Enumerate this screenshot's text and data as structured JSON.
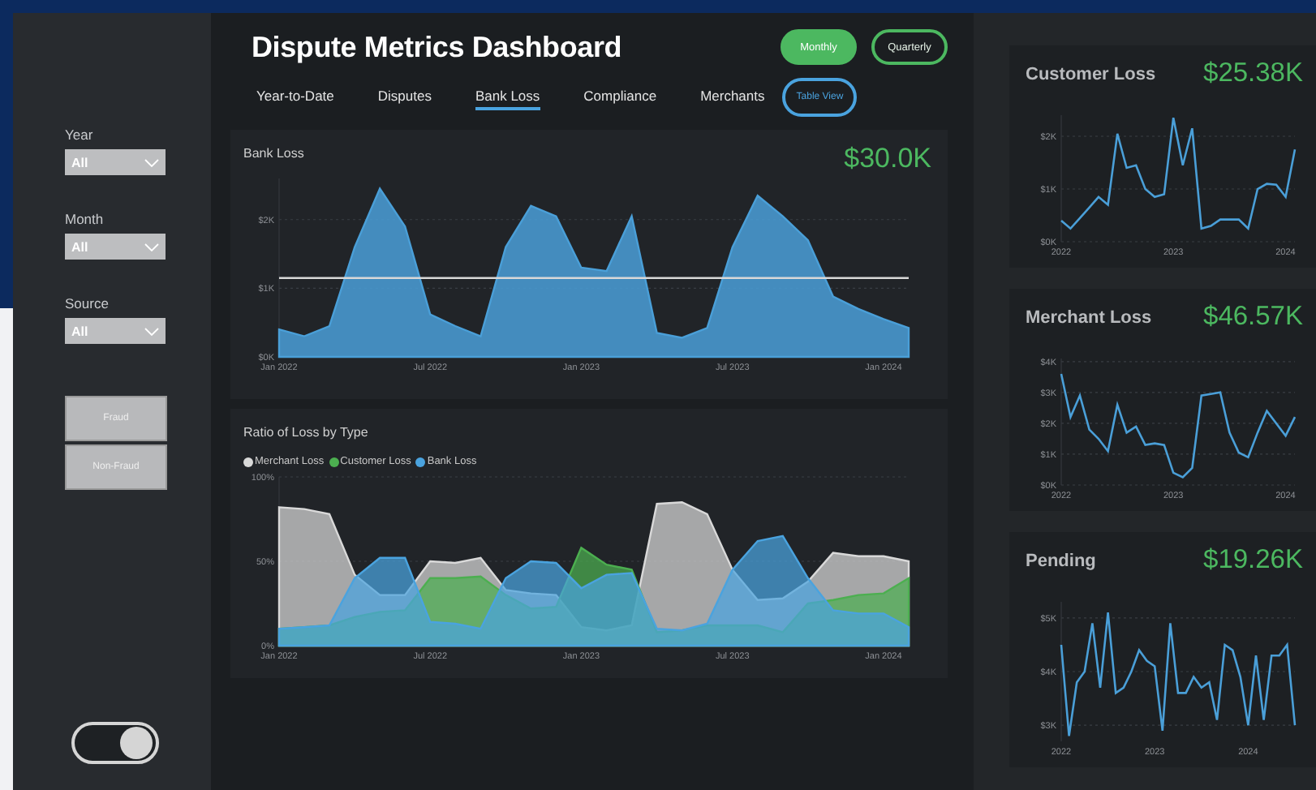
{
  "sidebar": {
    "filters": [
      {
        "label": "Year",
        "value": "All"
      },
      {
        "label": "Month",
        "value": "All"
      },
      {
        "label": "Source",
        "value": "All"
      }
    ],
    "buttons": [
      "Fraud",
      "Non-Fraud"
    ],
    "toggle": {
      "on": true
    }
  },
  "header": {
    "title": "Dispute Metrics Dashboard",
    "period_buttons": [
      {
        "label": "Monthly",
        "selected": true
      },
      {
        "label": "Quarterly",
        "selected": false
      }
    ],
    "tabs": [
      {
        "label": "Year-to-Date",
        "kind": "tab",
        "selected": false
      },
      {
        "label": "Disputes",
        "kind": "tab",
        "selected": false
      },
      {
        "label": "Bank Loss",
        "kind": "tab",
        "selected": true
      },
      {
        "label": "Compliance",
        "kind": "tab",
        "selected": false
      },
      {
        "label": "Merchants",
        "kind": "tab",
        "selected": false
      },
      {
        "label": "Table View",
        "kind": "button",
        "selected": false
      }
    ]
  },
  "bank_loss": {
    "title": "Bank Loss",
    "value": "$30.0K",
    "chart_data": {
      "type": "area",
      "grid": true,
      "categories": [
        "Jan 2022",
        null,
        null,
        null,
        null,
        null,
        "Jul 2022",
        null,
        null,
        null,
        null,
        null,
        "Jan 2023",
        null,
        null,
        null,
        null,
        null,
        "Jul 2023",
        null,
        null,
        null,
        null,
        null,
        "Jan 2024",
        null
      ],
      "ylim": [
        0,
        2.6
      ],
      "yticks": [
        {
          "value": 0,
          "label": "$0K"
        },
        {
          "value": 1,
          "label": "$1K"
        },
        {
          "value": 2,
          "label": "$2K"
        }
      ],
      "series": [
        {
          "color": "#4a9fd8",
          "values": [
            0.4,
            0.3,
            0.45,
            1.6,
            2.45,
            1.9,
            0.62,
            0.45,
            0.3,
            1.6,
            2.2,
            2.05,
            1.3,
            1.25,
            2.05,
            0.35,
            0.28,
            0.42,
            1.6,
            2.35,
            2.05,
            1.7,
            0.88,
            0.7,
            0.55,
            0.42
          ]
        }
      ],
      "ref_lines": [
        {
          "axis": "y",
          "value": 1.15
        }
      ]
    }
  },
  "ratio": {
    "title": "Ratio of Loss by Type",
    "chart_data": {
      "type": "area",
      "grid": true,
      "categories": [
        "Jan 2022",
        null,
        null,
        null,
        null,
        null,
        "Jul 2022",
        null,
        null,
        null,
        null,
        null,
        "Jan 2023",
        null,
        null,
        null,
        null,
        null,
        "Jul 2023",
        null,
        null,
        null,
        null,
        null,
        "Jan 2024",
        null
      ],
      "ylim": [
        0,
        100
      ],
      "yticks": [
        {
          "value": 0,
          "label": "0%"
        },
        {
          "value": 50,
          "label": "50%"
        },
        {
          "value": 100,
          "label": "100%"
        }
      ],
      "series": [
        {
          "name": "Merchant Loss",
          "color": "#d9d9d9",
          "values": [
            82,
            81,
            78,
            42,
            30,
            30,
            50,
            49,
            52,
            33,
            31,
            30,
            11,
            9,
            12,
            84,
            85,
            78,
            45,
            27,
            28,
            38,
            55,
            53,
            53,
            50
          ]
        },
        {
          "name": "Customer Loss",
          "color": "#4caf50",
          "values": [
            10,
            11,
            12,
            17,
            20,
            21,
            40,
            40,
            41,
            30,
            22,
            23,
            58,
            48,
            45,
            8,
            9,
            12,
            12,
            12,
            8,
            25,
            27,
            30,
            31,
            40
          ]
        },
        {
          "name": "Bank Loss",
          "color": "#4aa3df",
          "values": [
            10,
            11,
            12,
            40,
            52,
            52,
            14,
            13,
            10,
            40,
            50,
            49,
            34,
            42,
            43,
            10,
            9,
            13,
            45,
            62,
            65,
            40,
            21,
            19,
            19,
            11
          ]
        }
      ]
    }
  },
  "kpi_cards": [
    {
      "title": "Customer Loss",
      "value": "$25.38K",
      "chart_data": {
        "type": "line",
        "grid": true,
        "x": [
          2022,
          2022.083,
          2022.167,
          2022.25,
          2022.333,
          2022.417,
          2022.5,
          2022.583,
          2022.667,
          2022.75,
          2022.833,
          2022.917,
          2023,
          2023.083,
          2023.167,
          2023.25,
          2023.333,
          2023.417,
          2023.5,
          2023.583,
          2023.667,
          2023.75,
          2023.833,
          2023.917,
          2024,
          2024.083
        ],
        "xlim": [
          2022,
          2024.083
        ],
        "ylim": [
          0,
          2.4
        ],
        "yticks": [
          {
            "value": 0,
            "label": "$0K"
          },
          {
            "value": 1,
            "label": "$1K"
          },
          {
            "value": 2,
            "label": "$2K"
          }
        ],
        "xticks": [
          2022,
          2023,
          2024
        ],
        "series": [
          {
            "color": "#4a9fd8",
            "values": [
              0.4,
              0.25,
              0.45,
              0.65,
              0.85,
              0.7,
              2.05,
              1.4,
              1.45,
              1.0,
              0.85,
              0.9,
              2.35,
              1.45,
              2.15,
              0.25,
              0.3,
              0.42,
              0.42,
              0.42,
              0.25,
              1.0,
              1.1,
              1.08,
              0.85,
              1.75
            ]
          }
        ]
      }
    },
    {
      "title": "Merchant Loss",
      "value": "$46.57K",
      "chart_data": {
        "type": "line",
        "grid": true,
        "x": [
          2022,
          2022.083,
          2022.167,
          2022.25,
          2022.333,
          2022.417,
          2022.5,
          2022.583,
          2022.667,
          2022.75,
          2022.833,
          2022.917,
          2023,
          2023.083,
          2023.167,
          2023.25,
          2023.333,
          2023.417,
          2023.5,
          2023.583,
          2023.667,
          2023.75,
          2023.833,
          2023.917,
          2024,
          2024.083
        ],
        "xlim": [
          2022,
          2024.083
        ],
        "ylim": [
          0,
          4.1
        ],
        "yticks": [
          {
            "value": 0,
            "label": "$0K"
          },
          {
            "value": 1,
            "label": "$1K"
          },
          {
            "value": 2,
            "label": "$2K"
          },
          {
            "value": 3,
            "label": "$3K"
          },
          {
            "value": 4,
            "label": "$4K"
          }
        ],
        "xticks": [
          2022,
          2023,
          2024
        ],
        "series": [
          {
            "color": "#4a9fd8",
            "values": [
              3.6,
              2.2,
              2.9,
              1.8,
              1.5,
              1.1,
              2.6,
              1.7,
              1.9,
              1.3,
              1.35,
              1.3,
              0.4,
              0.25,
              0.55,
              2.9,
              2.95,
              3.0,
              1.7,
              1.05,
              0.9,
              1.7,
              2.4,
              2.0,
              1.6,
              2.2
            ]
          }
        ]
      }
    },
    {
      "title": "Pending",
      "value": "$19.26K",
      "chart_data": {
        "type": "line",
        "grid": true,
        "x": [
          2022,
          2022.083,
          2022.167,
          2022.25,
          2022.333,
          2022.417,
          2022.5,
          2022.583,
          2022.667,
          2022.75,
          2022.833,
          2022.917,
          2023,
          2023.083,
          2023.167,
          2023.25,
          2023.333,
          2023.417,
          2023.5,
          2023.583,
          2023.667,
          2023.75,
          2023.833,
          2023.917,
          2024,
          2024.083,
          2024.167,
          2024.25,
          2024.333,
          2024.417,
          2024.5
        ],
        "xlim": [
          2022,
          2024.5
        ],
        "ylim": [
          2.7,
          5.3
        ],
        "yticks": [
          {
            "value": 3,
            "label": "$3K"
          },
          {
            "value": 4,
            "label": "$4K"
          },
          {
            "value": 5,
            "label": "$5K"
          }
        ],
        "xticks": [
          2022,
          2023,
          2024
        ],
        "series": [
          {
            "color": "#4a9fd8",
            "values": [
              4.5,
              2.8,
              3.8,
              4.0,
              4.9,
              3.7,
              5.1,
              3.6,
              3.7,
              4.0,
              4.4,
              4.2,
              4.1,
              2.9,
              4.9,
              3.6,
              3.6,
              3.9,
              3.7,
              3.8,
              3.1,
              4.5,
              4.4,
              3.9,
              3.0,
              4.3,
              3.1,
              4.3,
              4.3,
              4.5,
              3.0
            ]
          }
        ]
      }
    }
  ]
}
